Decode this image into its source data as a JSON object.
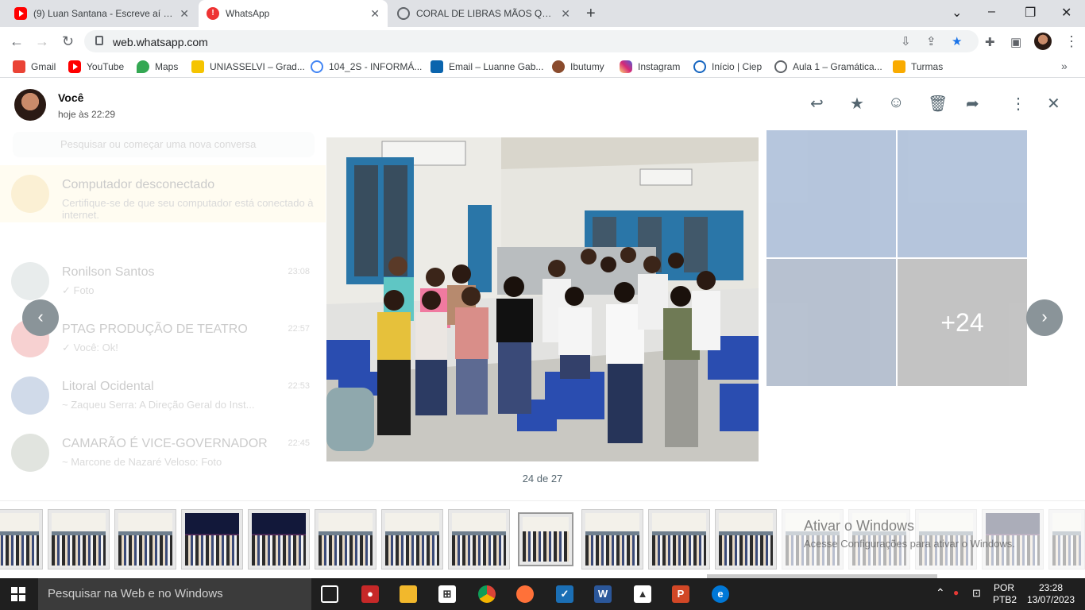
{
  "browser": {
    "tabs": [
      {
        "title": "(9) Luan Santana - Escreve aí - (Vi",
        "icon": "youtube-icon"
      },
      {
        "title": "WhatsApp",
        "icon": "whatsapp-icon"
      },
      {
        "title": "CORAL DE LIBRAS MÃOS QUE EN",
        "icon": "globe-icon"
      }
    ],
    "url": "web.whatsapp.com",
    "bookmarks": [
      {
        "label": "Gmail",
        "icon": "gmail-icon",
        "color": "#ea4335"
      },
      {
        "label": "YouTube",
        "icon": "youtube-icon",
        "color": "#ff0000"
      },
      {
        "label": "Maps",
        "icon": "maps-icon",
        "color": "#34a853"
      },
      {
        "label": "UNIASSELVI – Grad...",
        "icon": "uniasselvi-icon",
        "color": "#f5c400"
      },
      {
        "label": "104_2S - INFORMÁ...",
        "icon": "google-icon",
        "color": "#4285f4"
      },
      {
        "label": "Email – Luanne Gab...",
        "icon": "outlook-icon",
        "color": "#0a64ad"
      },
      {
        "label": "Ibutumy",
        "icon": "ibutumy-icon",
        "color": "#8a4b2d"
      },
      {
        "label": "Instagram",
        "icon": "instagram-icon",
        "color": "#d62976"
      },
      {
        "label": "Início | Ciep",
        "icon": "ciep-icon",
        "color": "#1565c0"
      },
      {
        "label": "Aula 1 – Gramática...",
        "icon": "globe-icon",
        "color": "#5f6368"
      },
      {
        "label": "Turmas",
        "icon": "classroom-icon",
        "color": "#f9ab00"
      }
    ]
  },
  "viewer": {
    "sender": "Você",
    "time": "hoje às 22:29",
    "counter": "24 de 27",
    "more_count": "+24"
  },
  "background_chats": [
    {
      "name": "Computador desconectado",
      "message": "Certifique-se de que seu computador está conectado à internet.",
      "time": ""
    },
    {
      "name": "Ronilson Santos",
      "message": "✓ Foto",
      "time": "23:08"
    },
    {
      "name": "PTAG PRODUÇÃO DE TEATRO",
      "message": "✓ Você: Ok!",
      "time": "22:57"
    },
    {
      "name": "Litoral Ocidental",
      "message": "~ Zaqueu Serra: A Direção Geral do Inst...",
      "time": "22:53"
    },
    {
      "name": "CAMARÃO É VICE-GOVERNADOR",
      "message": "~ Marcone de Nazaré Veloso: Foto",
      "time": "22:45"
    }
  ],
  "search_placeholder": "Pesquisar ou começar uma nova conversa",
  "watermark": {
    "title": "Ativar o Windows",
    "subtitle": "Acesse Configurações para ativar o Windows."
  },
  "taskbar": {
    "search": "Pesquisar na Web e no Windows",
    "lang1": "POR",
    "lang2": "PTB2",
    "time": "23:28",
    "date": "13/07/2023"
  }
}
